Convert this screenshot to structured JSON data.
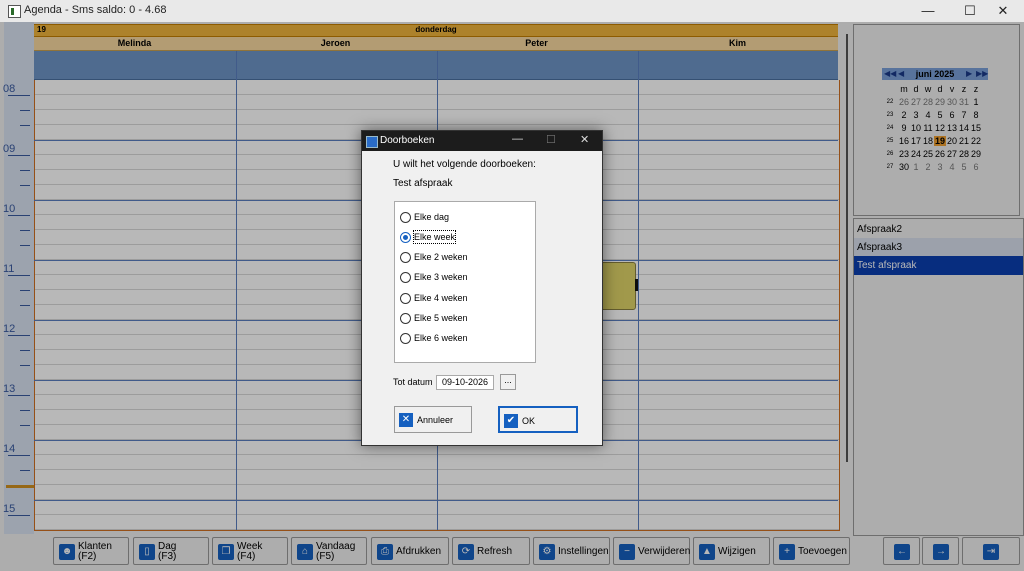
{
  "window": {
    "title": "Agenda - Sms saldo: 0 - 4.68",
    "minimize": "—",
    "maximize": "☐",
    "close": "✕"
  },
  "day": {
    "number": "19",
    "name": "donderdag"
  },
  "people": [
    "Melinda",
    "Jeroen",
    "Peter",
    "Kim"
  ],
  "hours": [
    "08",
    "09",
    "10",
    "11",
    "12",
    "13",
    "14",
    "15"
  ],
  "minical": {
    "month": "juni 2025",
    "prev_year": "◀◀",
    "prev": "◀",
    "next": "▶",
    "next_year": "▶▶",
    "dow": [
      "m",
      "d",
      "w",
      "d",
      "v",
      "z",
      "z"
    ],
    "weeks": [
      {
        "wk": "22",
        "days": [
          "26",
          "27",
          "28",
          "29",
          "30",
          "31",
          "1"
        ]
      },
      {
        "wk": "23",
        "days": [
          "2",
          "3",
          "4",
          "5",
          "6",
          "7",
          "8"
        ]
      },
      {
        "wk": "24",
        "days": [
          "9",
          "10",
          "11",
          "12",
          "13",
          "14",
          "15"
        ]
      },
      {
        "wk": "25",
        "days": [
          "16",
          "17",
          "18",
          "19",
          "20",
          "21",
          "22"
        ]
      },
      {
        "wk": "26",
        "days": [
          "23",
          "24",
          "25",
          "26",
          "27",
          "28",
          "29"
        ]
      },
      {
        "wk": "27",
        "days": [
          "30",
          "1",
          "2",
          "3",
          "4",
          "5",
          "6"
        ]
      }
    ]
  },
  "list": [
    "Afspraak2",
    "Afspraak3",
    "Test afspraak"
  ],
  "toolbar": [
    {
      "label": "Klanten\n(F2)",
      "icon": "person-icon"
    },
    {
      "label": "Dag\n(F3)",
      "icon": "page-icon"
    },
    {
      "label": "Week\n(F4)",
      "icon": "copy-icon"
    },
    {
      "label": "Vandaag\n(F5)",
      "icon": "home-icon"
    },
    {
      "label": "Afdrukken",
      "icon": "printer-icon"
    },
    {
      "label": "Refresh",
      "icon": "refresh-icon"
    },
    {
      "label": "Instellingen",
      "icon": "gear-icon"
    },
    {
      "label": "Verwijderen",
      "icon": "minus-icon"
    },
    {
      "label": "Wijzigen",
      "icon": "triangle-icon"
    },
    {
      "label": "Toevoegen",
      "icon": "plus-icon"
    }
  ],
  "nav": {
    "prev": "←",
    "next": "→",
    "exit": "⇥"
  },
  "dialog": {
    "title": "Doorboeken",
    "prompt": "U wilt het volgende doorboeken:",
    "item": "Test afspraak",
    "options": [
      "Elke dag",
      "Elke week",
      "Elke 2 weken",
      "Elke 3 weken",
      "Elke 4 weken",
      "Elke 5 weken",
      "Elke 6 weken"
    ],
    "selected_option": "Elke week",
    "until_label": "Tot datum",
    "until_value": "09-10-2026",
    "dots": "...",
    "cancel_label": "Annuleer",
    "ok_label": "OK"
  }
}
